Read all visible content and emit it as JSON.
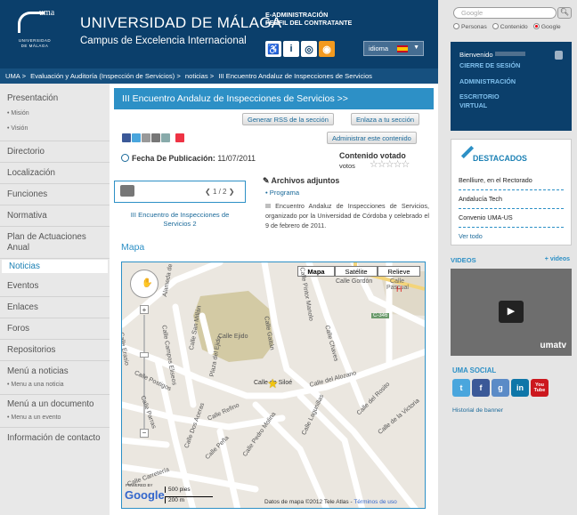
{
  "header": {
    "logo_text": "uma",
    "logo_subtext_line1": "UNIVERSIDAD",
    "logo_subtext_line2": "DE MÁLAGA",
    "title": "UNIVERSIDAD DE MÁLAGA",
    "subtitle": "Campus de Excelencia Internacional",
    "eadmin_line1": "E-ADMINISTRACIÓN",
    "eadmin_line2": "PERFIL DEL CONTRATANTE",
    "icons": [
      "accessibility-icon",
      "info-icon",
      "web-icon",
      "rss-icon"
    ],
    "idioma_label": "idioma"
  },
  "breadcrumb": [
    "UMA >",
    "Evaluación y Auditoría (Inspección de Servicios) >",
    "noticias >",
    "III Encuentro Andaluz de Inspecciones de Servicios"
  ],
  "nav": {
    "items": [
      {
        "label": "Presentación"
      },
      {
        "label": "• Misión",
        "sub": true
      },
      {
        "label": "• Visión",
        "sub": true
      },
      {
        "label": "Directorio"
      },
      {
        "label": "Localización"
      },
      {
        "label": "Funciones"
      },
      {
        "label": "Normativa"
      },
      {
        "label": "Plan de Actuaciones Anual"
      },
      {
        "label": "Noticias",
        "active": true
      },
      {
        "label": "Eventos"
      },
      {
        "label": "Enlaces"
      },
      {
        "label": "Foros"
      },
      {
        "label": "Repositorios"
      },
      {
        "label": "Menú a noticias"
      },
      {
        "label": "• Menu a una noticia",
        "sub": true
      },
      {
        "label": "Menú a un documento"
      },
      {
        "label": "• Menu a un evento",
        "sub": true
      },
      {
        "label": "Información de contacto"
      }
    ]
  },
  "main": {
    "section_title": "III Encuentro Andaluz de Inspecciones de Servicios >>",
    "rss_button": "Generar RSS de la sección",
    "link_button": "Enlaza a tu sección",
    "admin_button": "Administrar este contenido",
    "pubdate_label": "Fecha De Publicación:",
    "pubdate_value": "11/07/2011",
    "votado_label": "Contenido votado",
    "votos_label": "votos",
    "pager": "1 / 2",
    "gallery_caption": "III Encuentro de Inspecciones de Servicios 2",
    "adjuntos_title": "Archivos adjuntos",
    "adjunto_item": "• Programa",
    "description": "III Encuentro Andaluz de Inspecciones de Servicios, organizado por la Universidad de Córdoba y celebrado el 9 de febrero de 2011.",
    "mapa_title": "Mapa"
  },
  "map": {
    "types": [
      "Mapa",
      "Satélite",
      "Relieve"
    ],
    "streets": [
      "Alameda de los Tristes",
      "Calle Gordón",
      "Calle Pascual",
      "Calle Pintor Manolo",
      "Calle Carretería",
      "Calle San Millán",
      "Calle Chaves",
      "Calle Ejido",
      "Plaza del Ejido",
      "Calle Campos Eliseos",
      "Calle Gaitán",
      "Calle Postigos",
      "Calle Refino",
      "Calle Pedro Molina",
      "Calle de Siloé",
      "Calle del Alozano",
      "Calle Lagunillas",
      "Calle del Rosito",
      "Calle de la Victoria",
      "Calle Dos Aceras",
      "Calle Parras",
      "Calle Peña",
      "Calle Erasio"
    ],
    "road_badge": "C-346",
    "scale_1": "500 pies",
    "scale_2": "200 m",
    "powered": "POWERED BY",
    "google": "Google",
    "copyright": "Datos de mapa ©2012 Tele Atlas -",
    "terms": "Términos de uso"
  },
  "sidebar": {
    "search_placeholder": "Google",
    "radio_options": [
      "Personas",
      "Contenido",
      "Google"
    ],
    "welcome": "Bienvenido",
    "user_links": [
      "CIERRE DE SESIÓN",
      "ADMINISTRACIÓN",
      "ESCRITORIO VIRTUAL"
    ],
    "destacados_title": "DESTACADOS",
    "destacados": [
      "Benlliure, en el Rectorado",
      "Andalucía Tech",
      "Convenio UMA-US"
    ],
    "ver_todo": "Ver todo",
    "videos_title": "VIDEOS",
    "videos_more": "+ videos",
    "umatv": "umatv",
    "social_title": "UMA SOCIAL",
    "social": [
      "t",
      "f",
      "g",
      "in",
      "You Tube"
    ],
    "historial": "Historial de banner"
  },
  "colors": {
    "header": "#0b3f6b",
    "accent": "#2d90c6",
    "link": "#1b6a9a"
  }
}
